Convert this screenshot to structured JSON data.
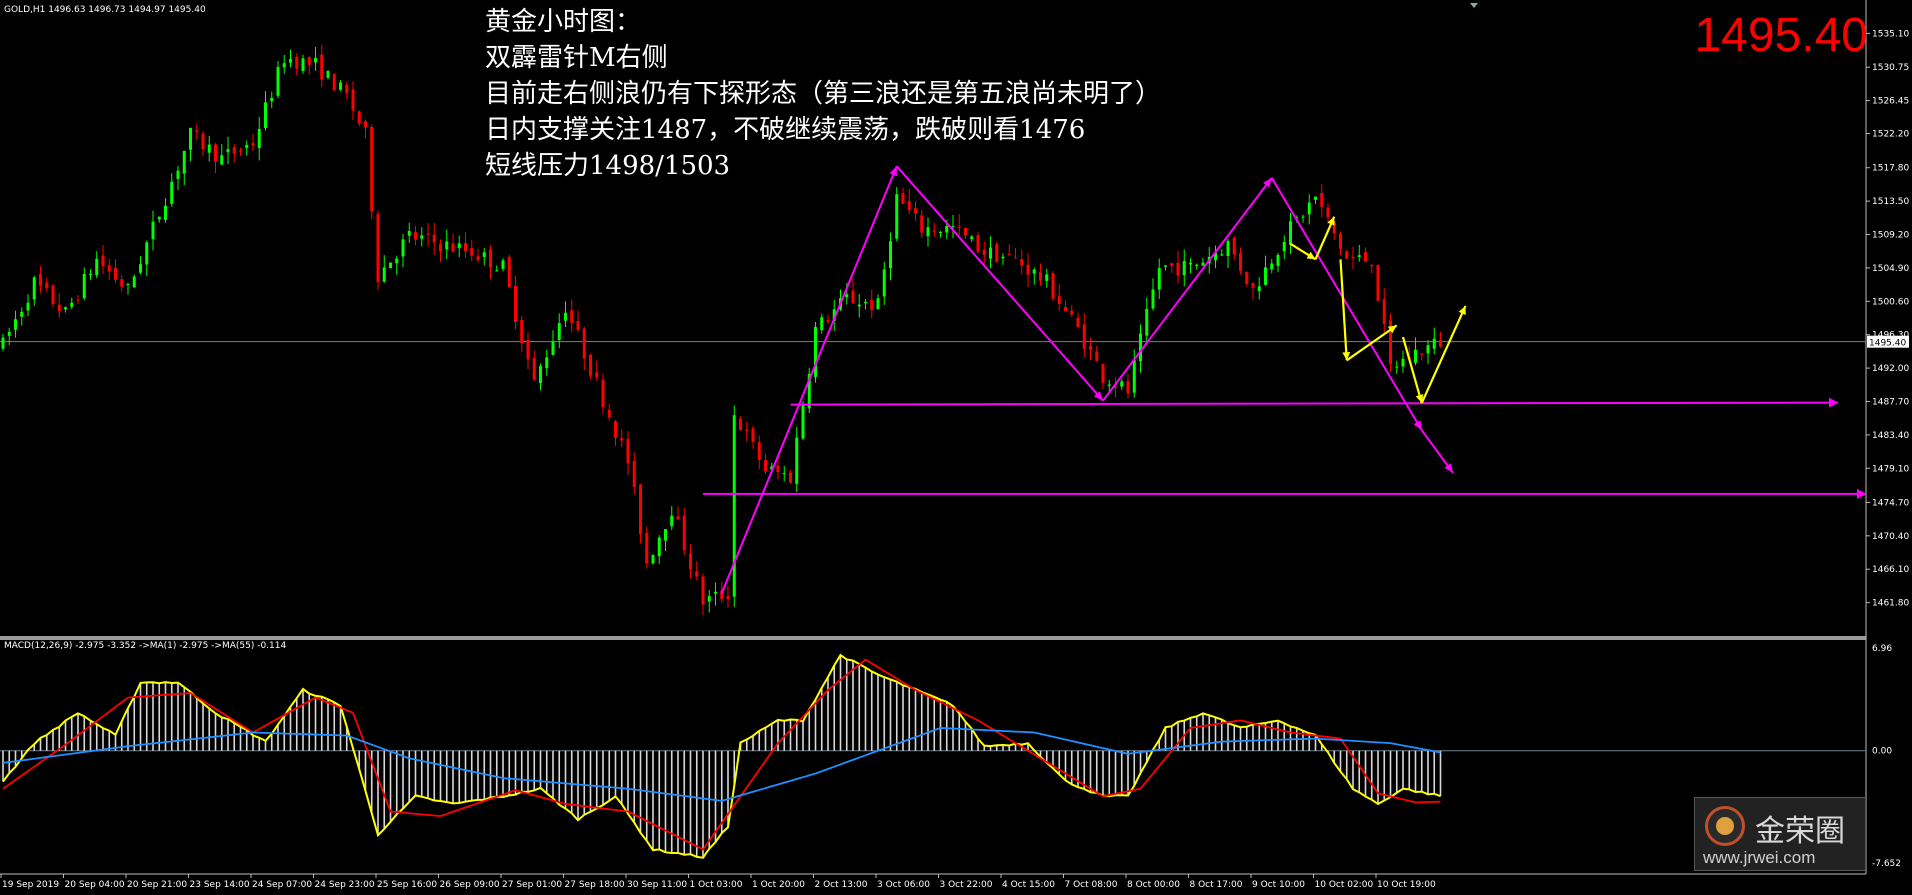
{
  "header": {
    "symbol_line": "GOLD,H1  1496.63 1496.73 1494.97 1495.40",
    "big_price": "1495.40"
  },
  "annotation": {
    "lines": [
      "黄金小时图：",
      "双霹雷针M右侧",
      "目前走右侧浪仍有下探形态（第三浪还是第五浪尚未明了）",
      "日内支撑关注1487，不破继续震荡，跌破则看1476",
      "短线压力1498/1503"
    ]
  },
  "macd_header": "MACD(12,26,9) -2.975 -3.352  ->MA(1) -2.975  ->MA(55) -0.114",
  "watermark": {
    "name": "金荣圈",
    "url": "www.jrwei.com"
  },
  "colors": {
    "bull": "#00ff00",
    "bear": "#ff0000",
    "pattern": "#ff00ff",
    "projection": "#ffff00",
    "signal_red": "#ff0000",
    "ma_blue": "#1e90ff",
    "macd_yellow": "#ffff00",
    "price_line": "#708090"
  },
  "chart_data": {
    "type": "candlestick",
    "instrument": "GOLD",
    "timeframe": "H1",
    "current_price": 1495.4,
    "ylim": [
      1457.5,
      1539.4
    ],
    "y_ticks": [
      "1539.40",
      "1535.10",
      "1530.75",
      "1526.45",
      "1522.20",
      "1517.80",
      "1513.50",
      "1509.20",
      "1504.90",
      "1500.60",
      "1496.30",
      "1492.00",
      "1487.70",
      "1483.40",
      "1479.10",
      "1474.70",
      "1470.40",
      "1466.10",
      "1461.80",
      "1457.50"
    ],
    "x_ticks": [
      "19 Sep 2019",
      "20 Sep 04:00",
      "20 Sep 21:00",
      "23 Sep 14:00",
      "24 Sep 07:00",
      "24 Sep 23:00",
      "25 Sep 16:00",
      "26 Sep 09:00",
      "27 Sep 01:00",
      "27 Sep 18:00",
      "30 Sep 11:00",
      "1 Oct 03:00",
      "1 Oct 20:00",
      "2 Oct 13:00",
      "3 Oct 06:00",
      "3 Oct 22:00",
      "4 Oct 15:00",
      "7 Oct 08:00",
      "8 Oct 00:00",
      "8 Oct 17:00",
      "9 Oct 10:00",
      "10 Oct 02:00",
      "10 Oct 19:00"
    ],
    "bar_count": 231,
    "close_path": [
      {
        "bar": 0,
        "price": 1495
      },
      {
        "bar": 5,
        "price": 1503
      },
      {
        "bar": 10,
        "price": 1499
      },
      {
        "bar": 15,
        "price": 1506
      },
      {
        "bar": 20,
        "price": 1502
      },
      {
        "bar": 25,
        "price": 1512
      },
      {
        "bar": 30,
        "price": 1522
      },
      {
        "bar": 35,
        "price": 1519
      },
      {
        "bar": 40,
        "price": 1521
      },
      {
        "bar": 45,
        "price": 1532
      },
      {
        "bar": 50,
        "price": 1531
      },
      {
        "bar": 55,
        "price": 1527
      },
      {
        "bar": 58,
        "price": 1522
      },
      {
        "bar": 60,
        "price": 1504
      },
      {
        "bar": 65,
        "price": 1509
      },
      {
        "bar": 70,
        "price": 1508
      },
      {
        "bar": 75,
        "price": 1507
      },
      {
        "bar": 80,
        "price": 1505
      },
      {
        "bar": 85,
        "price": 1490
      },
      {
        "bar": 90,
        "price": 1500
      },
      {
        "bar": 95,
        "price": 1490
      },
      {
        "bar": 100,
        "price": 1480
      },
      {
        "bar": 103,
        "price": 1467
      },
      {
        "bar": 107,
        "price": 1474
      },
      {
        "bar": 112,
        "price": 1462
      },
      {
        "bar": 116,
        "price": 1463
      },
      {
        "bar": 117,
        "price": 1486
      },
      {
        "bar": 122,
        "price": 1479
      },
      {
        "bar": 126,
        "price": 1478
      },
      {
        "bar": 130,
        "price": 1497
      },
      {
        "bar": 135,
        "price": 1501
      },
      {
        "bar": 140,
        "price": 1500
      },
      {
        "bar": 143,
        "price": 1514
      },
      {
        "bar": 147,
        "price": 1510
      },
      {
        "bar": 152,
        "price": 1510
      },
      {
        "bar": 157,
        "price": 1507
      },
      {
        "bar": 162,
        "price": 1506
      },
      {
        "bar": 167,
        "price": 1503
      },
      {
        "bar": 172,
        "price": 1497
      },
      {
        "bar": 176,
        "price": 1491
      },
      {
        "bar": 180,
        "price": 1489
      },
      {
        "bar": 185,
        "price": 1505
      },
      {
        "bar": 190,
        "price": 1505
      },
      {
        "bar": 196,
        "price": 1508
      },
      {
        "bar": 200,
        "price": 1502
      },
      {
        "bar": 205,
        "price": 1509
      },
      {
        "bar": 210,
        "price": 1514
      },
      {
        "bar": 215,
        "price": 1506
      },
      {
        "bar": 219,
        "price": 1506
      },
      {
        "bar": 222,
        "price": 1492
      },
      {
        "bar": 226,
        "price": 1494
      },
      {
        "bar": 230,
        "price": 1495.4
      }
    ],
    "horizontal_levels": [
      {
        "name": "support-1487",
        "price": 1487.3
      },
      {
        "name": "support-1476",
        "price": 1475.8
      }
    ],
    "pattern_path": [
      {
        "bar": 115,
        "price": 1463
      },
      {
        "bar": 143,
        "price": 1518
      },
      {
        "bar": 176,
        "price": 1487.8
      },
      {
        "bar": 203,
        "price": 1516.5
      },
      {
        "bar": 227,
        "price": 1484
      },
      {
        "bar": 232,
        "price": 1478.5
      }
    ],
    "projection_paths": [
      [
        {
          "bar": 206,
          "price": 1508
        },
        {
          "bar": 210,
          "price": 1506
        },
        {
          "bar": 213,
          "price": 1511.5
        }
      ],
      [
        {
          "bar": 214,
          "price": 1506
        },
        {
          "bar": 215,
          "price": 1493
        },
        {
          "bar": 223,
          "price": 1497.5
        }
      ],
      [
        {
          "bar": 224,
          "price": 1496
        },
        {
          "bar": 227,
          "price": 1487.5
        },
        {
          "bar": 234,
          "price": 1500
        }
      ]
    ],
    "macd": {
      "ylim": [
        -7.652,
        6.96
      ],
      "y_ticks": [
        "6.96",
        "0.00",
        "-7.652"
      ],
      "last_values": {
        "macd": -2.975,
        "signal": -3.352,
        "ma1": -2.975,
        "ma55": -0.114
      },
      "histogram_path": [
        {
          "bar": 0,
          "value": -2
        },
        {
          "bar": 5,
          "value": 0.5
        },
        {
          "bar": 12,
          "value": 2.5
        },
        {
          "bar": 18,
          "value": 1
        },
        {
          "bar": 22,
          "value": 4.5
        },
        {
          "bar": 28,
          "value": 4.5
        },
        {
          "bar": 34,
          "value": 2.5
        },
        {
          "bar": 42,
          "value": 0.6
        },
        {
          "bar": 48,
          "value": 4.0
        },
        {
          "bar": 54,
          "value": 3
        },
        {
          "bar": 60,
          "value": -5.5
        },
        {
          "bar": 66,
          "value": -3
        },
        {
          "bar": 72,
          "value": -3.5
        },
        {
          "bar": 80,
          "value": -3
        },
        {
          "bar": 86,
          "value": -2.5
        },
        {
          "bar": 92,
          "value": -4.5
        },
        {
          "bar": 98,
          "value": -3
        },
        {
          "bar": 104,
          "value": -6.5
        },
        {
          "bar": 112,
          "value": -7
        },
        {
          "bar": 116,
          "value": -5
        },
        {
          "bar": 118,
          "value": 0.5
        },
        {
          "bar": 124,
          "value": 2
        },
        {
          "bar": 128,
          "value": 2
        },
        {
          "bar": 134,
          "value": 6.3
        },
        {
          "bar": 140,
          "value": 5
        },
        {
          "bar": 146,
          "value": 4
        },
        {
          "bar": 152,
          "value": 3
        },
        {
          "bar": 157,
          "value": 0.3
        },
        {
          "bar": 164,
          "value": 0.5
        },
        {
          "bar": 170,
          "value": -2
        },
        {
          "bar": 176,
          "value": -3
        },
        {
          "bar": 180,
          "value": -3
        },
        {
          "bar": 186,
          "value": 1.5
        },
        {
          "bar": 192,
          "value": 2.5
        },
        {
          "bar": 198,
          "value": 1.5
        },
        {
          "bar": 204,
          "value": 2
        },
        {
          "bar": 210,
          "value": 1
        },
        {
          "bar": 216,
          "value": -2.5
        },
        {
          "bar": 220,
          "value": -3.5
        },
        {
          "bar": 224,
          "value": -2.5
        },
        {
          "bar": 230,
          "value": -2.975
        }
      ],
      "signal_path": [
        {
          "bar": 0,
          "value": -2.5
        },
        {
          "bar": 10,
          "value": 0.4
        },
        {
          "bar": 20,
          "value": 3.5
        },
        {
          "bar": 30,
          "value": 3.8
        },
        {
          "bar": 40,
          "value": 1.2
        },
        {
          "bar": 50,
          "value": 3.5
        },
        {
          "bar": 56,
          "value": 2.5
        },
        {
          "bar": 62,
          "value": -4
        },
        {
          "bar": 70,
          "value": -4.3
        },
        {
          "bar": 82,
          "value": -2.6
        },
        {
          "bar": 90,
          "value": -3.5
        },
        {
          "bar": 100,
          "value": -4
        },
        {
          "bar": 112,
          "value": -6.5
        },
        {
          "bar": 118,
          "value": -3
        },
        {
          "bar": 124,
          "value": 0.5
        },
        {
          "bar": 132,
          "value": 4
        },
        {
          "bar": 138,
          "value": 6
        },
        {
          "bar": 146,
          "value": 4
        },
        {
          "bar": 156,
          "value": 2
        },
        {
          "bar": 164,
          "value": 0
        },
        {
          "bar": 176,
          "value": -3
        },
        {
          "bar": 182,
          "value": -2.5
        },
        {
          "bar": 190,
          "value": 1.5
        },
        {
          "bar": 198,
          "value": 2
        },
        {
          "bar": 206,
          "value": 1.2
        },
        {
          "bar": 214,
          "value": 0.8
        },
        {
          "bar": 220,
          "value": -2.8
        },
        {
          "bar": 226,
          "value": -3.4
        },
        {
          "bar": 230,
          "value": -3.352
        }
      ],
      "ma55_path": [
        {
          "bar": 0,
          "value": -0.8
        },
        {
          "bar": 20,
          "value": 0.3
        },
        {
          "bar": 40,
          "value": 1.2
        },
        {
          "bar": 55,
          "value": 1.0
        },
        {
          "bar": 65,
          "value": -0.5
        },
        {
          "bar": 80,
          "value": -1.8
        },
        {
          "bar": 100,
          "value": -2.5
        },
        {
          "bar": 115,
          "value": -3.3
        },
        {
          "bar": 130,
          "value": -1.5
        },
        {
          "bar": 150,
          "value": 1.5
        },
        {
          "bar": 165,
          "value": 1.2
        },
        {
          "bar": 180,
          "value": -0.2
        },
        {
          "bar": 195,
          "value": 0.6
        },
        {
          "bar": 210,
          "value": 0.8
        },
        {
          "bar": 222,
          "value": 0.5
        },
        {
          "bar": 230,
          "value": -0.114
        }
      ]
    }
  }
}
